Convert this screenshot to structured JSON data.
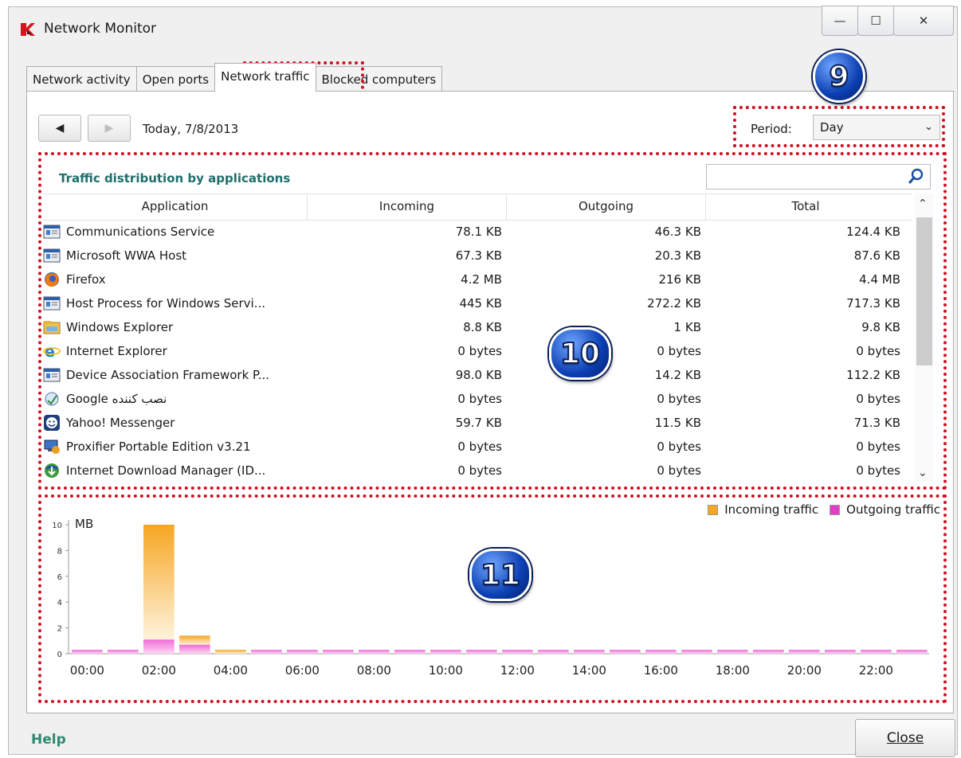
{
  "window": {
    "title": "Network Monitor",
    "buttons": {
      "minimize": "—",
      "maximize": "☐",
      "close": "✕"
    }
  },
  "markers": {
    "m9": "9",
    "m10": "10",
    "m11": "11"
  },
  "tabs": [
    {
      "label": "Network activity",
      "active": false
    },
    {
      "label": "Open ports",
      "active": false
    },
    {
      "label": "Network traffic",
      "active": true
    },
    {
      "label": "Blocked computers",
      "active": false
    }
  ],
  "toolbar": {
    "back": "◀",
    "forward": "▶",
    "date": "Today, 7/8/2013",
    "period_label": "Period:",
    "period_value": "Day",
    "period_chevron": "⌄"
  },
  "apps_table": {
    "title": "Traffic distribution by applications",
    "search_placeholder": "",
    "columns": [
      "Application",
      "Incoming",
      "Outgoing",
      "Total"
    ],
    "rows": [
      {
        "icon": "service-icon",
        "name": "Communications Service",
        "incoming": "78.1 KB",
        "outgoing": "46.3 KB",
        "total": "124.4 KB"
      },
      {
        "icon": "service-icon",
        "name": "Microsoft WWA Host",
        "incoming": "67.3 KB",
        "outgoing": "20.3 KB",
        "total": "87.6 KB"
      },
      {
        "icon": "firefox-icon",
        "name": "Firefox",
        "incoming": "4.2 MB",
        "outgoing": "216 KB",
        "total": "4.4 MB"
      },
      {
        "icon": "service-icon",
        "name": "Host Process for Windows Servi...",
        "incoming": "445 KB",
        "outgoing": "272.2 KB",
        "total": "717.3 KB"
      },
      {
        "icon": "explorer-icon",
        "name": "Windows Explorer",
        "incoming": "8.8 KB",
        "outgoing": "1 KB",
        "total": "9.8 KB"
      },
      {
        "icon": "internet-explorer-icon",
        "name": "Internet Explorer",
        "incoming": "0 bytes",
        "outgoing": "0 bytes",
        "total": "0 bytes"
      },
      {
        "icon": "service-icon",
        "name": "Device Association Framework P...",
        "incoming": "98.0 KB",
        "outgoing": "14.2 KB",
        "total": "112.2 KB"
      },
      {
        "icon": "installer-icon",
        "name": "Google نصب کننده",
        "incoming": "0 bytes",
        "outgoing": "0 bytes",
        "total": "0 bytes"
      },
      {
        "icon": "yahoo-messenger-icon",
        "name": "Yahoo! Messenger",
        "incoming": "59.7 KB",
        "outgoing": "11.5 KB",
        "total": "71.3 KB"
      },
      {
        "icon": "proxifier-icon",
        "name": "Proxifier Portable Edition v3.21",
        "incoming": "0 bytes",
        "outgoing": "0 bytes",
        "total": "0 bytes"
      },
      {
        "icon": "idm-icon",
        "name": "Internet Download Manager (ID...",
        "incoming": "0 bytes",
        "outgoing": "0 bytes",
        "total": "0 bytes"
      }
    ]
  },
  "chart_data": {
    "type": "bar",
    "title": "",
    "ylabel": "MB",
    "ylim": [
      0,
      10
    ],
    "yticks": [
      0,
      2,
      4,
      6,
      8,
      10
    ],
    "xtick_labels": [
      "00:00",
      "02:00",
      "04:00",
      "06:00",
      "08:00",
      "10:00",
      "12:00",
      "14:00",
      "16:00",
      "18:00",
      "20:00",
      "22:00"
    ],
    "categories": [
      "00:00",
      "01:00",
      "02:00",
      "03:00",
      "04:00",
      "05:00",
      "06:00",
      "07:00",
      "08:00",
      "09:00",
      "10:00",
      "11:00",
      "12:00",
      "13:00",
      "14:00",
      "15:00",
      "16:00",
      "17:00",
      "18:00",
      "19:00",
      "20:00",
      "21:00",
      "22:00",
      "23:00"
    ],
    "stacked": true,
    "legend_position": "top-right",
    "series": [
      {
        "name": "Incoming traffic",
        "color": "#f5a623",
        "values": [
          0,
          0,
          8.9,
          0.7,
          0.3,
          0,
          0,
          0,
          0,
          0,
          0,
          0,
          0,
          0,
          0,
          0,
          0,
          0,
          0,
          0,
          0,
          0,
          0,
          0
        ]
      },
      {
        "name": "Outgoing traffic",
        "color": "#e23fc8",
        "values": [
          0.3,
          0.3,
          1.1,
          0.7,
          0,
          0.3,
          0.3,
          0.3,
          0.3,
          0.3,
          0.3,
          0.3,
          0.3,
          0.3,
          0.3,
          0.3,
          0.3,
          0.3,
          0.3,
          0.3,
          0.3,
          0.3,
          0.3,
          0.3
        ]
      }
    ]
  },
  "footer": {
    "help": "Help",
    "close": "Close"
  }
}
